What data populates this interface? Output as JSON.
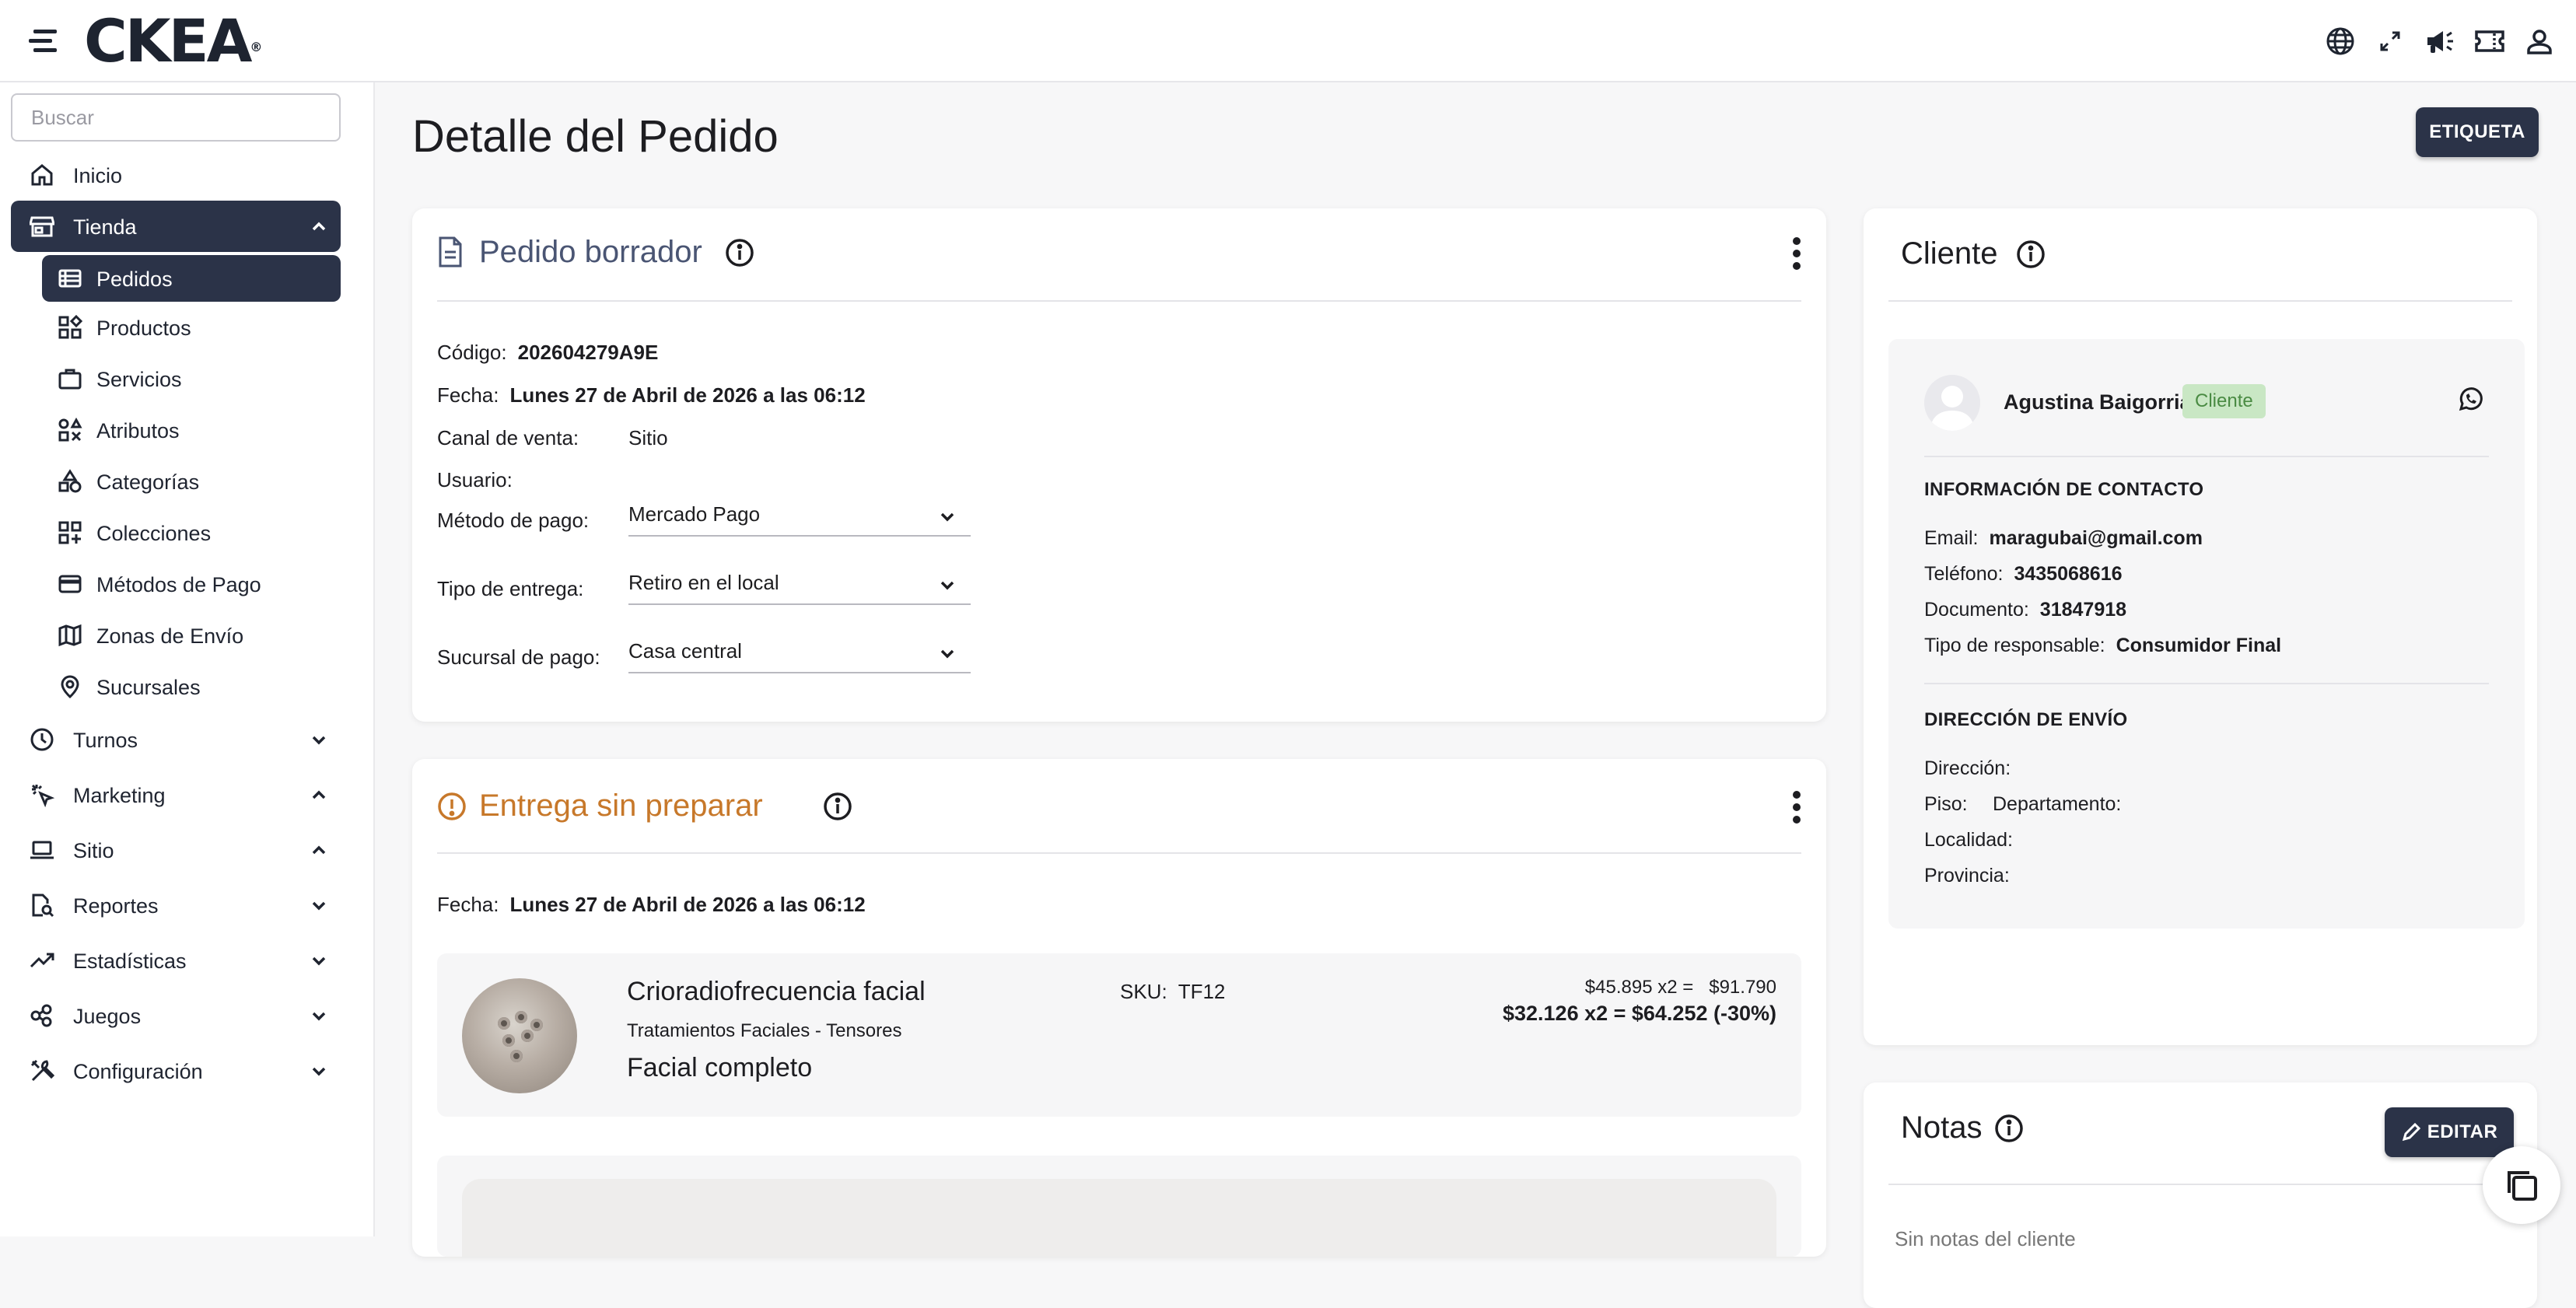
{
  "app": {
    "logo": "CKEA",
    "logo_mark": "®"
  },
  "topbar": {
    "icons": [
      "globe-icon",
      "fullscreen-icon",
      "megaphone-icon",
      "ticket-icon",
      "user-icon"
    ]
  },
  "sidebar": {
    "search_placeholder": "Buscar",
    "items": [
      {
        "label": "Inicio"
      },
      {
        "label": "Tienda"
      },
      {
        "label": "Pedidos"
      },
      {
        "label": "Productos"
      },
      {
        "label": "Servicios"
      },
      {
        "label": "Atributos"
      },
      {
        "label": "Categorías"
      },
      {
        "label": "Colecciones"
      },
      {
        "label": "Métodos de Pago"
      },
      {
        "label": "Zonas de Envío"
      },
      {
        "label": "Sucursales"
      },
      {
        "label": "Turnos"
      },
      {
        "label": "Marketing"
      },
      {
        "label": "Sitio"
      },
      {
        "label": "Reportes"
      },
      {
        "label": "Estadísticas"
      },
      {
        "label": "Juegos"
      },
      {
        "label": "Configuración"
      }
    ]
  },
  "page": {
    "title": "Detalle del Pedido",
    "label_button": "ETIQUETA"
  },
  "order": {
    "title": "Pedido borrador",
    "code_label": "Código:",
    "code": "202604279A9E",
    "date_label": "Fecha:",
    "date": "Lunes 27 de Abril de 2026 a las 06:12",
    "channel_label": "Canal de venta:",
    "channel": "Sitio",
    "user_label": "Usuario:",
    "payment_label": "Método de pago:",
    "payment": "Mercado Pago",
    "delivery_label": "Tipo de entrega:",
    "delivery": "Retiro en el local",
    "branch_label": "Sucursal de pago:",
    "branch": "Casa central"
  },
  "delivery": {
    "title": "Entrega sin preparar",
    "date_label": "Fecha:",
    "date": "Lunes 27 de Abril de 2026 a las 06:12",
    "item": {
      "name": "Crioradiofrecuencia facial",
      "category": "Tratamientos Faciales - Tensores",
      "variant": "Facial completo",
      "sku_label": "SKU:",
      "sku": "TF12",
      "price_line": "$45.895 x2 =   $91.790",
      "discount_line": "$32.126 x2 = $64.252 (-30%)"
    }
  },
  "client": {
    "title": "Cliente",
    "name": "Agustina Baigorria",
    "badge": "Cliente",
    "contact_heading": "INFORMACIÓN DE CONTACTO",
    "email_label": "Email:",
    "email": "maragubai@gmail.com",
    "phone_label": "Teléfono:",
    "phone": "3435068616",
    "doc_label": "Documento:",
    "doc": "31847918",
    "resp_label": "Tipo de responsable:",
    "resp": "Consumidor Final",
    "address_heading": "DIRECCIÓN DE ENVÍO",
    "address_label": "Dirección:",
    "floor_label": "Piso:",
    "apt_label": "Departamento:",
    "city_label": "Localidad:",
    "province_label": "Provincia:"
  },
  "notes": {
    "title": "Notas",
    "edit_button": "EDITAR",
    "empty": "Sin notas del cliente"
  },
  "colors": {
    "primary": "#2b3348",
    "warning": "#c7782a",
    "draft_title": "#4a5573",
    "badge_bg": "#c9e7c4",
    "badge_fg": "#4a8b43"
  }
}
